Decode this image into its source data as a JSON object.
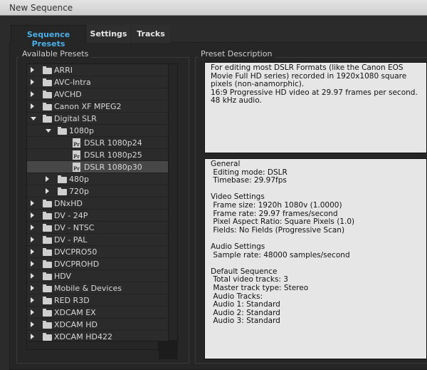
{
  "window": {
    "title": "New Sequence"
  },
  "tabs": [
    {
      "label": "Sequence Presets",
      "active": true
    },
    {
      "label": "Settings",
      "active": false
    },
    {
      "label": "Tracks",
      "active": false
    }
  ],
  "colors": {
    "active_tab": "#4aaee6",
    "selected_row": "#474747"
  },
  "presets": {
    "label": "Available Presets",
    "items": [
      {
        "label": "ARRI",
        "level": 0,
        "type": "folder",
        "expanded": false
      },
      {
        "label": "AVC-Intra",
        "level": 0,
        "type": "folder",
        "expanded": false
      },
      {
        "label": "AVCHD",
        "level": 0,
        "type": "folder",
        "expanded": false
      },
      {
        "label": "Canon XF MPEG2",
        "level": 0,
        "type": "folder",
        "expanded": false
      },
      {
        "label": "Digital SLR",
        "level": 0,
        "type": "folder",
        "expanded": true
      },
      {
        "label": "1080p",
        "level": 1,
        "type": "folder",
        "expanded": true
      },
      {
        "label": "DSLR 1080p24",
        "level": 2,
        "type": "preset"
      },
      {
        "label": "DSLR 1080p25",
        "level": 2,
        "type": "preset"
      },
      {
        "label": "DSLR 1080p30",
        "level": 2,
        "type": "preset",
        "selected": true
      },
      {
        "label": "480p",
        "level": 1,
        "type": "folder",
        "expanded": false
      },
      {
        "label": "720p",
        "level": 1,
        "type": "folder",
        "expanded": false
      },
      {
        "label": "DNxHD",
        "level": 0,
        "type": "folder",
        "expanded": false
      },
      {
        "label": "DV - 24P",
        "level": 0,
        "type": "folder",
        "expanded": false
      },
      {
        "label": "DV - NTSC",
        "level": 0,
        "type": "folder",
        "expanded": false
      },
      {
        "label": "DV - PAL",
        "level": 0,
        "type": "folder",
        "expanded": false
      },
      {
        "label": "DVCPRO50",
        "level": 0,
        "type": "folder",
        "expanded": false
      },
      {
        "label": "DVCPROHD",
        "level": 0,
        "type": "folder",
        "expanded": false
      },
      {
        "label": "HDV",
        "level": 0,
        "type": "folder",
        "expanded": false
      },
      {
        "label": "Mobile & Devices",
        "level": 0,
        "type": "folder",
        "expanded": false
      },
      {
        "label": "RED R3D",
        "level": 0,
        "type": "folder",
        "expanded": false
      },
      {
        "label": "XDCAM EX",
        "level": 0,
        "type": "folder",
        "expanded": false
      },
      {
        "label": "XDCAM HD",
        "level": 0,
        "type": "folder",
        "expanded": false
      },
      {
        "label": "XDCAM HD422",
        "level": 0,
        "type": "folder",
        "expanded": false
      }
    ]
  },
  "description": {
    "label": "Preset Description",
    "text": "For editing most DSLR Formats (like the Canon EOS Movie Full HD series) recorded in 1920x1080 square pixels (non-anamorphic).\n16:9 Progressive HD video at 29.97 frames per second.\n48 kHz audio.",
    "details": "General\n Editing mode: DSLR\n Timebase: 29.97fps\n\nVideo Settings\n Frame size: 1920h 1080v (1.0000)\n Frame rate: 29.97 frames/second\n Pixel Aspect Ratio: Square Pixels (1.0)\n Fields: No Fields (Progressive Scan)\n\nAudio Settings\n Sample rate: 48000 samples/second\n\nDefault Sequence\n Total video tracks: 3\n Master track type: Stereo\n Audio Tracks:\n Audio 1: Standard\n Audio 2: Standard\n Audio 3: Standard"
  }
}
